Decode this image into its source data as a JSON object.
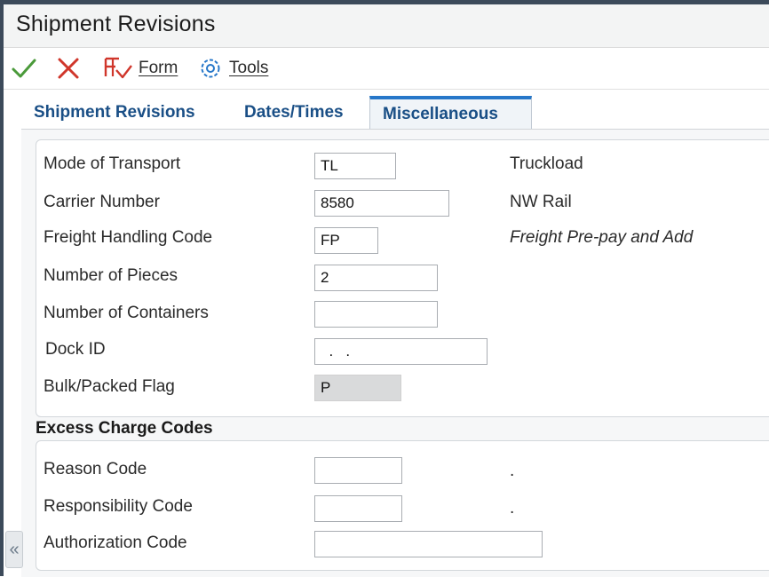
{
  "window": {
    "title": "Shipment Revisions"
  },
  "toolbar": {
    "ok_icon": "check-icon",
    "cancel_icon": "close-icon",
    "form_label": "Form",
    "tools_label": "Tools",
    "colors": {
      "ok": "#4a9a3a",
      "cancel": "#d0362b",
      "form": "#d0362b",
      "tools": "#2677c9"
    }
  },
  "tabs": [
    {
      "label": "Shipment Revisions"
    },
    {
      "label": "Dates/Times"
    },
    {
      "label": "Miscellaneous",
      "active": true
    }
  ],
  "form": {
    "mode_of_transport": {
      "label": "Mode of Transport",
      "value": "TL",
      "description": "Truckload"
    },
    "carrier_number": {
      "label": "Carrier Number",
      "value": "8580",
      "description": "NW Rail"
    },
    "freight_handling_code": {
      "label": "Freight Handling Code",
      "value": "FP",
      "description": "Freight Pre-pay and Add"
    },
    "number_of_pieces": {
      "label": "Number of Pieces",
      "value": "2"
    },
    "number_of_containers": {
      "label": "Number of Containers",
      "value": ""
    },
    "dock_id": {
      "label": "Dock ID",
      "value": "  .   ."
    },
    "bulk_packed_flag": {
      "label": "Bulk/Packed Flag",
      "value": "P"
    }
  },
  "excess": {
    "heading": "Excess Charge Codes",
    "reason_code": {
      "label": "Reason Code",
      "value": "",
      "description": "."
    },
    "responsibility_code": {
      "label": "Responsibility Code",
      "value": "",
      "description": "."
    },
    "authorization_code": {
      "label": "Authorization Code",
      "value": ""
    }
  },
  "sidebar": {
    "collapse_glyph": "«"
  }
}
